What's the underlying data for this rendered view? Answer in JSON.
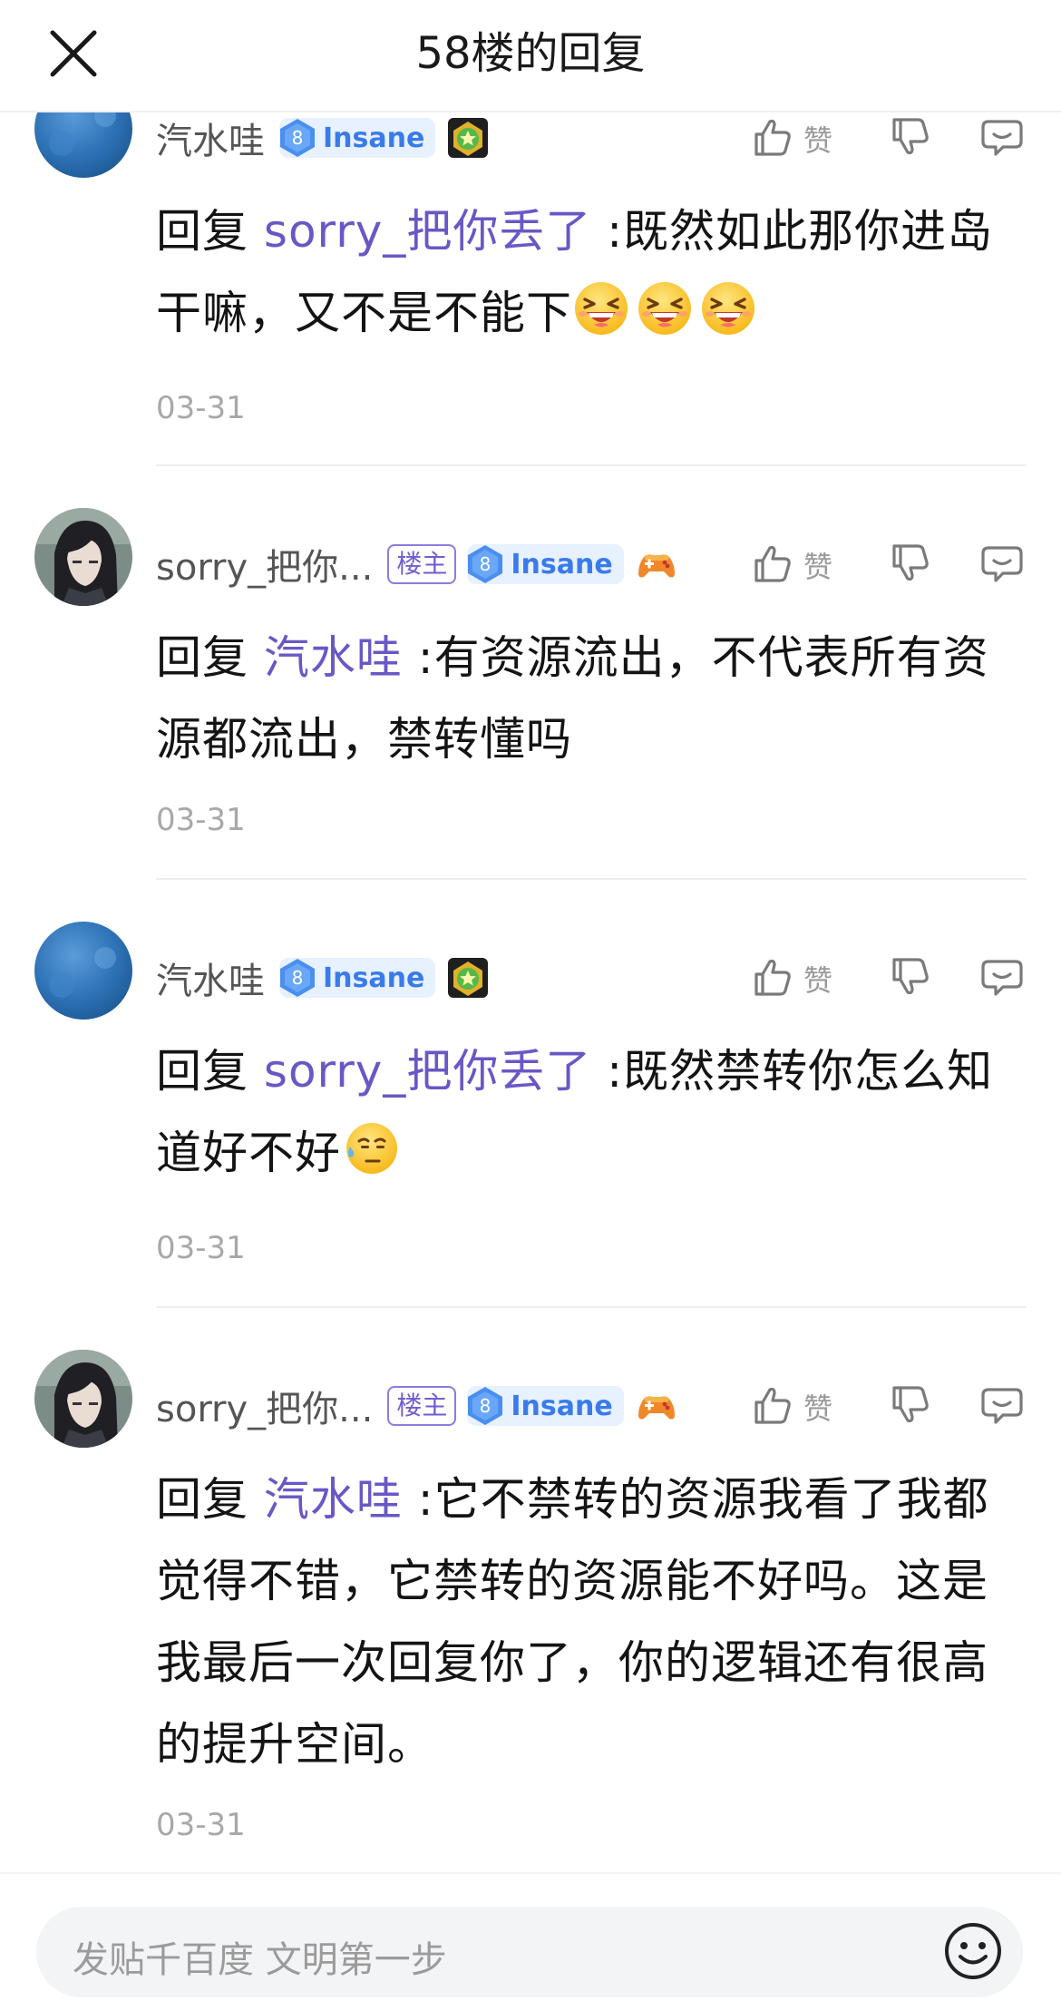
{
  "header": {
    "title": "58楼的回复"
  },
  "replies": [
    {
      "user": "汽水哇",
      "is_owner": false,
      "owner_label": "",
      "level_num": "8",
      "level_name": "Insane",
      "extra_icon": "green-star-medal-icon",
      "like_label": "赞",
      "prefix": "回复 ",
      "mention": "sorry_把你丢了",
      "text": " :既然如此那你进岛干嘛，又不是不能下",
      "emojis": [
        "grinning-squint-face",
        "grinning-squint-face",
        "grinning-squint-face"
      ],
      "date": "03-31"
    },
    {
      "user": "sorry_把你...",
      "is_owner": true,
      "owner_label": "楼主",
      "level_num": "8",
      "level_name": "Insane",
      "extra_icon": "game-controller-icon",
      "like_label": "赞",
      "prefix": "回复 ",
      "mention": "汽水哇",
      "text": " :有资源流出，不代表所有资源都流出，禁转懂吗",
      "emojis": [],
      "date": "03-31"
    },
    {
      "user": "汽水哇",
      "is_owner": false,
      "owner_label": "",
      "level_num": "8",
      "level_name": "Insane",
      "extra_icon": "green-star-medal-icon",
      "like_label": "赞",
      "prefix": "回复 ",
      "mention": "sorry_把你丢了",
      "text": " :既然禁转你怎么知道好不好",
      "emojis": [
        "sweat-face"
      ],
      "date": "03-31"
    },
    {
      "user": "sorry_把你...",
      "is_owner": true,
      "owner_label": "楼主",
      "level_num": "8",
      "level_name": "Insane",
      "extra_icon": "game-controller-icon",
      "like_label": "赞",
      "prefix": "回复 ",
      "mention": "汽水哇",
      "text": " :它不禁转的资源我看了我都觉得不错，它禁转的资源能不好吗。这是我最后一次回复你了，你的逻辑还有很高的提升空间。",
      "emojis": [],
      "date": "03-31"
    }
  ],
  "composer": {
    "placeholder": "发贴千百度 文明第一步"
  },
  "colors": {
    "mention": "#6a57c6",
    "level_badge": "#3a7bea",
    "owner_badge": "#6f5fcf"
  }
}
